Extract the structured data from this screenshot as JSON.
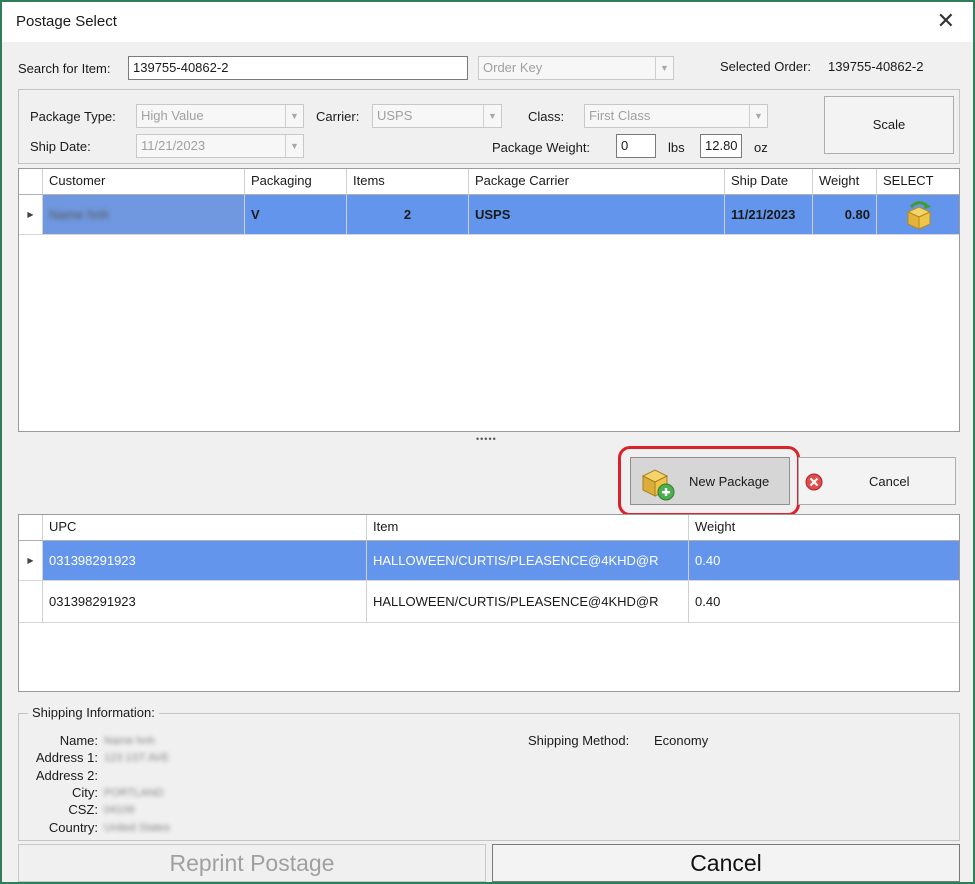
{
  "window": {
    "title": "Postage Select"
  },
  "search": {
    "label": "Search for Item:",
    "value": "139755-40862-2",
    "key_combo": "Order Key",
    "selected_order_label": "Selected Order:",
    "selected_order_value": "139755-40862-2"
  },
  "package": {
    "type_label": "Package Type:",
    "type_value": "High Value",
    "carrier_label": "Carrier:",
    "carrier_value": "USPS",
    "class_label": "Class:",
    "class_value": "First Class",
    "ship_date_label": "Ship Date:",
    "ship_date_value": "11/21/2023",
    "weight_label": "Package Weight:",
    "lbs_value": "0",
    "lbs_unit": "lbs",
    "oz_value": "12.80",
    "oz_unit": "oz",
    "scale_button": "Scale"
  },
  "packages_grid": {
    "columns": [
      "Customer",
      "Packaging",
      "Items",
      "Package Carrier",
      "Ship Date",
      "Weight",
      "SELECT"
    ],
    "rows": [
      {
        "customer": "Name hnh",
        "packaging": "V",
        "items": "2",
        "carrier": "USPS",
        "ship_date": "11/21/2023",
        "weight": "0.80"
      }
    ]
  },
  "splitter": "•••••",
  "actions": {
    "new_package": "New Package",
    "cancel": "Cancel"
  },
  "items_grid": {
    "columns": [
      "UPC",
      "Item",
      "Weight"
    ],
    "rows": [
      {
        "upc": "031398291923",
        "item": "HALLOWEEN/CURTIS/PLEASENCE@4KHD@R",
        "weight": "0.40"
      },
      {
        "upc": "031398291923",
        "item": "HALLOWEEN/CURTIS/PLEASENCE@4KHD@R",
        "weight": "0.40"
      }
    ]
  },
  "shipping_info": {
    "legend": "Shipping Information:",
    "name_label": "Name:",
    "name_value": "Name hnh",
    "address1_label": "Address 1:",
    "address1_value": "123 1ST AVE",
    "address2_label": "Address 2:",
    "address2_value": "",
    "city_label": "City:",
    "city_value": "PORTLAND",
    "csz_label": "CSZ:",
    "csz_value": "04106",
    "country_label": "Country:",
    "country_value": "United States",
    "method_label": "Shipping Method:",
    "method_value": "Economy"
  },
  "footer": {
    "reprint": "Reprint Postage",
    "cancel": "Cancel"
  },
  "colors": {
    "selection": "#6495ed",
    "highlight_ring": "#d9222a",
    "window_border": "#2e7d5b"
  }
}
